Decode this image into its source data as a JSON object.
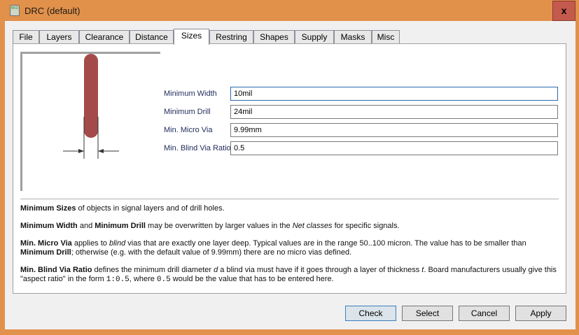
{
  "window": {
    "title": "DRC (default)",
    "icon_text": "BRD",
    "close": "x"
  },
  "tabs": [
    "File",
    "Layers",
    "Clearance",
    "Distance",
    "Sizes",
    "Restring",
    "Shapes",
    "Supply",
    "Masks",
    "Misc"
  ],
  "active_tab": "Sizes",
  "fields": [
    {
      "label": "Minimum Width",
      "value": "10mil"
    },
    {
      "label": "Minimum Drill",
      "value": "24mil"
    },
    {
      "label": "Min. Micro Via",
      "value": "9.99mm"
    },
    {
      "label": "Min. Blind Via Ratio",
      "value": "0.5"
    }
  ],
  "desc": {
    "p1_b": "Minimum Sizes",
    "p1": " of objects in signal layers and of drill holes.",
    "p2_b1": "Minimum Width",
    "p2_a": " and ",
    "p2_b2": "Minimum Drill",
    "p2_b": " may be overwritten by larger values in the ",
    "p2_i": "Net classes",
    "p2_c": " for specific signals.",
    "p3_b1": "Min. Micro Via",
    "p3_a": " applies to ",
    "p3_i": "blind",
    "p3_b": " vias that are exactly one layer deep. Typical values are in the range 50..100 micron. The value has to be smaller than ",
    "p3_b2": "Minimum Drill",
    "p3_c": "; otherwise (e.g. with the default value of 9.99mm) there are no micro vias defined.",
    "p4_b": "Min. Blind Via Ratio",
    "p4_a": " defines the minimum drill diameter ",
    "p4_i": "d",
    "p4_b2": " a blind via must have if it goes through a layer of thickness ",
    "p4_i2": "t",
    "p4_c": ". Board manufacturers usually give this \"aspect ratio\" in the form ",
    "p4_m1": "1:0.5",
    "p4_d": ", where ",
    "p4_m2": "0.5",
    "p4_e": " would be the value that has to be entered here."
  },
  "buttons": {
    "check": "Check",
    "select": "Select",
    "cancel": "Cancel",
    "apply": "Apply"
  },
  "colors": {
    "titlebar": "#e2914a",
    "trace": "#a54a4a",
    "close": "#c45a4d"
  }
}
